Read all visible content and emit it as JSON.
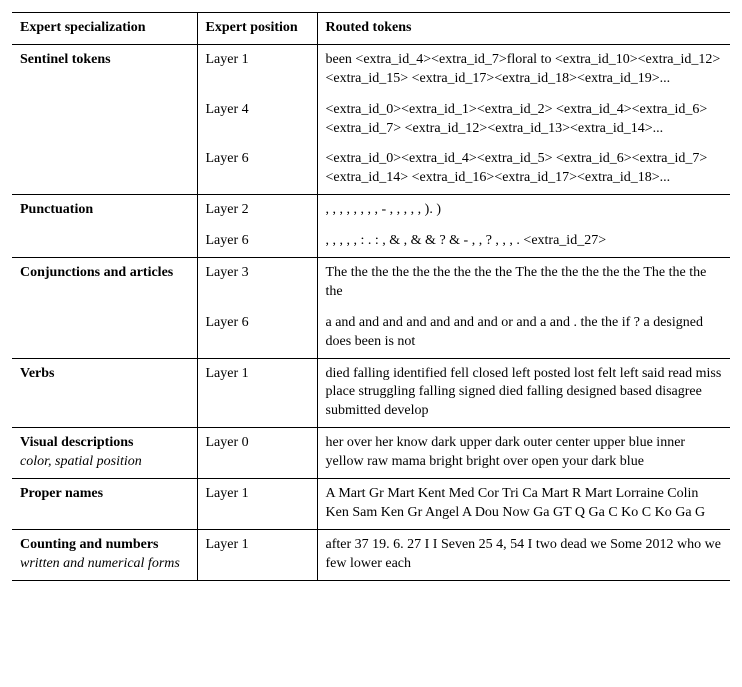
{
  "headers": {
    "col1": "Expert specialization",
    "col2": "Expert position",
    "col3": "Routed tokens"
  },
  "rows": [
    {
      "spec": "Sentinel tokens",
      "sub": "",
      "entries": [
        {
          "pos": "Layer 1",
          "tokens": "been <extra_id_4><extra_id_7>floral to <extra_id_10><extra_id_12><extra_id_15> <extra_id_17><extra_id_18><extra_id_19>..."
        },
        {
          "pos": "Layer 4",
          "tokens": "<extra_id_0><extra_id_1><extra_id_2> <extra_id_4><extra_id_6><extra_id_7> <extra_id_12><extra_id_13><extra_id_14>..."
        },
        {
          "pos": "Layer 6",
          "tokens": "<extra_id_0><extra_id_4><extra_id_5> <extra_id_6><extra_id_7><extra_id_14> <extra_id_16><extra_id_17><extra_id_18>..."
        }
      ]
    },
    {
      "spec": "Punctuation",
      "sub": "",
      "entries": [
        {
          "pos": "Layer 2",
          "tokens": ", , , , , , , , - , , , , , ). )"
        },
        {
          "pos": "Layer 6",
          "tokens": ", , , , , : . : , & , & & ? & - , , ? , , , . <extra_id_27>"
        }
      ]
    },
    {
      "spec": "Conjunctions and articles",
      "sub": "",
      "entries": [
        {
          "pos": "Layer 3",
          "tokens": "The the the the the the the the the The the the the the the The the the the"
        },
        {
          "pos": "Layer 6",
          "tokens": "a and and and and and and and or and a and . the the if ? a designed does been is not"
        }
      ]
    },
    {
      "spec": "Verbs",
      "sub": "",
      "entries": [
        {
          "pos": "Layer 1",
          "tokens": "died falling identified fell closed left posted lost felt left said read miss place struggling falling signed died falling designed based disagree submitted develop"
        }
      ]
    },
    {
      "spec": "Visual descriptions",
      "sub": "color, spatial position",
      "entries": [
        {
          "pos": "Layer 0",
          "tokens": "her over her know dark upper dark outer center upper blue inner yellow raw mama bright bright over open your dark blue"
        }
      ]
    },
    {
      "spec": "Proper names",
      "sub": "",
      "entries": [
        {
          "pos": "Layer 1",
          "tokens": "A Mart Gr Mart Kent Med Cor Tri Ca Mart R Mart Lorraine Colin Ken Sam Ken Gr Angel A Dou Now Ga GT Q Ga C Ko C Ko Ga G"
        }
      ]
    },
    {
      "spec": "Counting and numbers",
      "sub": "written and numerical forms",
      "entries": [
        {
          "pos": "Layer 1",
          "tokens": "after 37 19. 6. 27 I I Seven 25 4, 54 I two dead we Some 2012 who we few lower each"
        }
      ]
    }
  ]
}
